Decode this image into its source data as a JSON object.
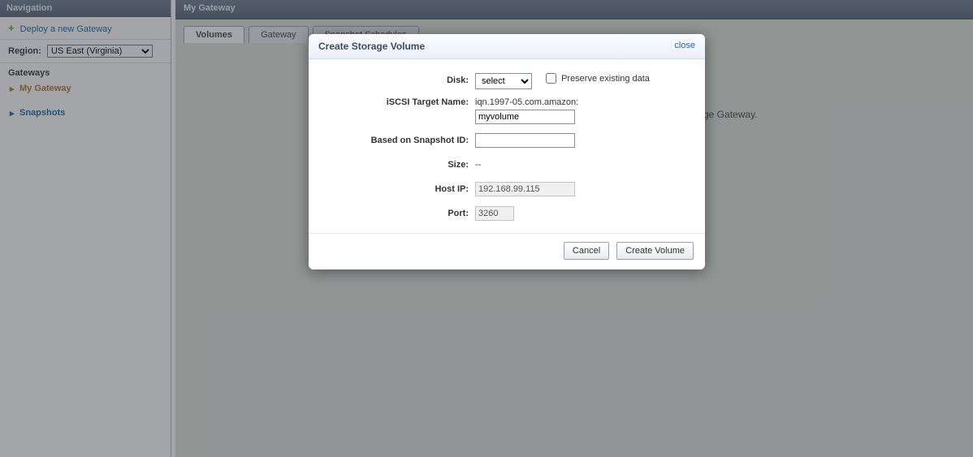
{
  "sidebar": {
    "title": "Navigation",
    "deploy_label": "Deploy a new Gateway",
    "region_label": "Region:",
    "region_value": "US East (Virginia)",
    "gateways_heading": "Gateways",
    "items": [
      "My Gateway",
      "Snapshots"
    ]
  },
  "main": {
    "title": "My Gateway",
    "tabs": [
      "Volumes",
      "Gateway",
      "Snapshot Schedules"
    ],
    "bg_text": "ge Gateway."
  },
  "modal": {
    "title": "Create Storage Volume",
    "close_label": "close",
    "fields": {
      "disk": {
        "label": "Disk:",
        "value": "select",
        "preserve_label": "Preserve existing data"
      },
      "iscsi": {
        "label": "iSCSI Target Name:",
        "prefix": "iqn.1997-05.com.amazon:",
        "value": "myvolume"
      },
      "snapshot": {
        "label": "Based on Snapshot ID:",
        "value": ""
      },
      "size": {
        "label": "Size:",
        "value": "--"
      },
      "hostip": {
        "label": "Host IP:",
        "value": "192.168.99.115"
      },
      "port": {
        "label": "Port:",
        "value": "3260"
      }
    },
    "buttons": {
      "cancel": "Cancel",
      "create": "Create Volume"
    }
  }
}
